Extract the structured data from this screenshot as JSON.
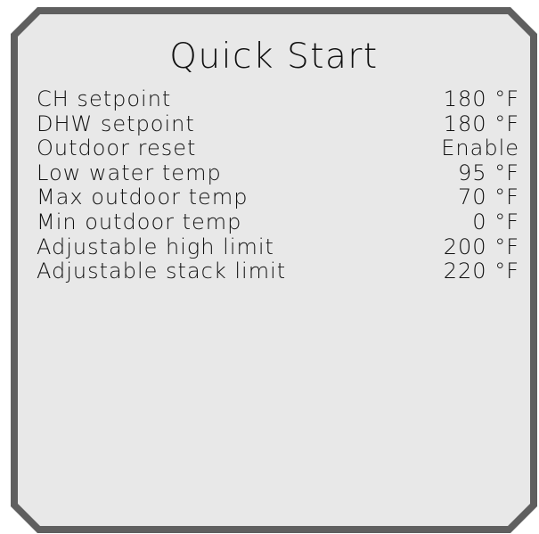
{
  "screen": {
    "title": "Quick Start",
    "settings": [
      {
        "label": "CH setpoint",
        "value": "180 °F"
      },
      {
        "label": "DHW setpoint",
        "value": "180 °F"
      },
      {
        "label": "Outdoor reset",
        "value": "Enable"
      },
      {
        "label": "Low water temp",
        "value": "95 °F"
      },
      {
        "label": "Max outdoor temp",
        "value": "70 °F"
      },
      {
        "label": "Min outdoor temp",
        "value": "0 °F"
      },
      {
        "label": "Adjustable high limit",
        "value": "200 °F"
      },
      {
        "label": "Adjustable stack limit",
        "value": "220 °F"
      }
    ]
  }
}
